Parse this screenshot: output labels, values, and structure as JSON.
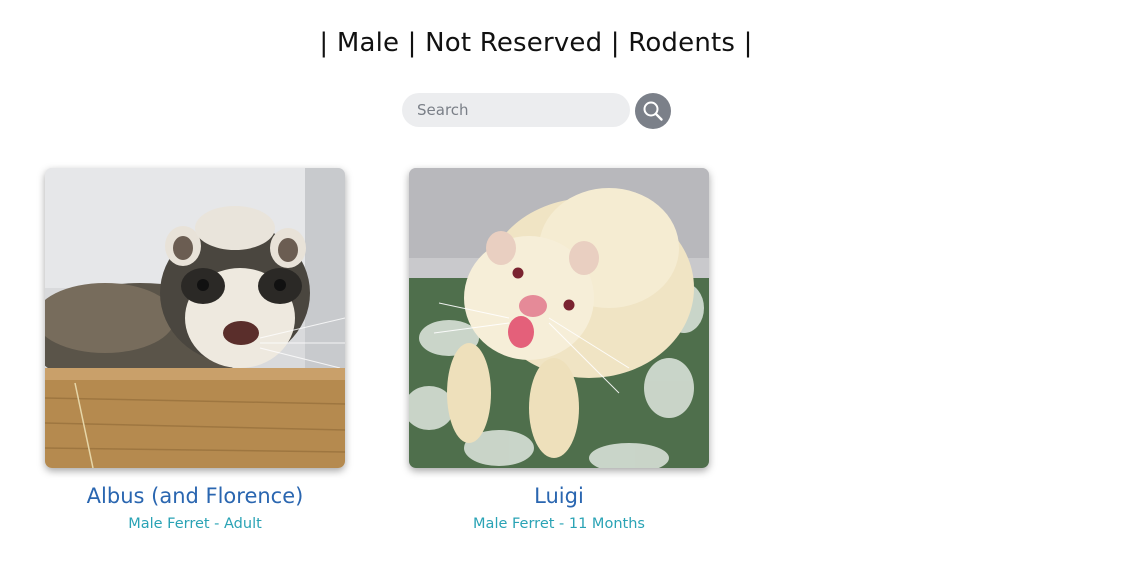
{
  "filter": {
    "title": "| Male | Not Reserved | Rodents |"
  },
  "search": {
    "placeholder": "Search",
    "icon": "search-icon"
  },
  "pets": [
    {
      "name": "Albus (and Florence)",
      "description": "Male Ferret - Adult"
    },
    {
      "name": "Luigi",
      "description": "Male Ferret - 11 Months"
    }
  ],
  "colors": {
    "name_link": "#2a66b0",
    "description": "#2aa3b5",
    "search_bg": "#ecedef",
    "search_button": "#7b8089"
  }
}
